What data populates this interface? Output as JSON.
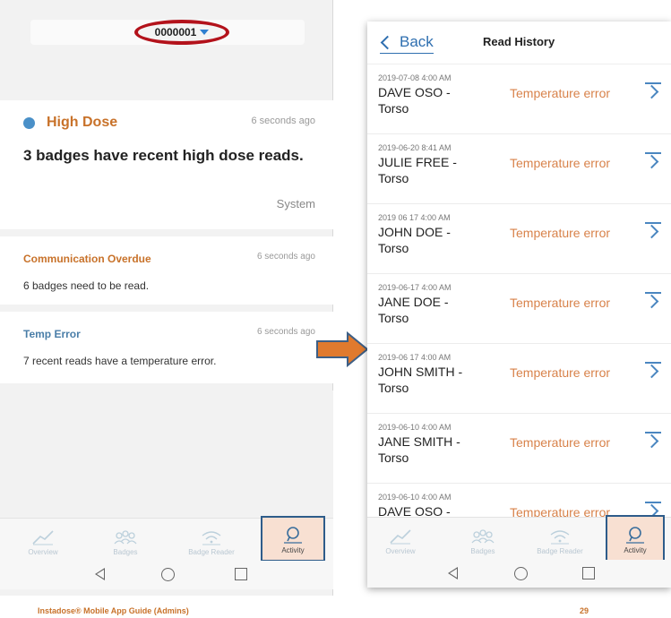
{
  "left_screen": {
    "badge_selector": {
      "value": "0000001"
    },
    "cards": {
      "high_dose": {
        "title": "High Dose",
        "time": "6 seconds ago",
        "message": "3 badges have recent high dose reads.",
        "source": "System"
      },
      "communication_overdue": {
        "title": "Communication Overdue",
        "time": "6 seconds ago",
        "message": "6 badges need to be read."
      },
      "temp_error": {
        "title": "Temp Error",
        "time": "6 seconds ago",
        "message": "7 recent reads have a temperature error."
      }
    },
    "tabs": [
      {
        "label": "Overview",
        "icon": "chart-line-icon"
      },
      {
        "label": "Badges",
        "icon": "users-icon"
      },
      {
        "label": "Badge Reader",
        "icon": "wifi-icon"
      },
      {
        "label": "Activity",
        "icon": "chat-bubble-icon",
        "active": true
      }
    ]
  },
  "right_screen": {
    "header": {
      "back_label": "Back",
      "title": "Read History"
    },
    "rows": [
      {
        "timestamp": "2019-07-08 4:00 AM",
        "name": "DAVE OSO -",
        "location": "Torso",
        "status": "Temperature error"
      },
      {
        "timestamp": "2019-06-20 8:41 AM",
        "name": "JULIE FREE -",
        "location": "Torso",
        "status": "Temperature error"
      },
      {
        "timestamp": "2019 06 17 4:00 AM",
        "name": "JOHN DOE -",
        "location": "Torso",
        "status": "Temperature error"
      },
      {
        "timestamp": "2019-06-17 4:00 AM",
        "name": "JANE DOE -",
        "location": "Torso",
        "status": "Temperature error"
      },
      {
        "timestamp": "2019-06 17 4:00 AM",
        "name": "JOHN SMITH -",
        "location": "Torso",
        "status": "Temperature error"
      },
      {
        "timestamp": "2019-06-10 4:00 AM",
        "name": "JANE SMITH -",
        "location": "Torso",
        "status": "Temperature error"
      },
      {
        "timestamp": "2019-06-10 4:00 AM",
        "name": "DAVE OSO -",
        "location": "",
        "status": "Temperature error"
      }
    ],
    "tabs": [
      {
        "label": "Overview",
        "icon": "chart-line-icon"
      },
      {
        "label": "Badges",
        "icon": "users-icon"
      },
      {
        "label": "Badge Reader",
        "icon": "wifi-icon"
      },
      {
        "label": "Activity",
        "icon": "chat-bubble-icon",
        "active": true
      }
    ]
  },
  "colors": {
    "accent_orange": "#c8722a",
    "link_blue": "#2f6fb0",
    "highlight_red": "#b3121b",
    "arrow_orange": "#e07a2e"
  },
  "footer": {
    "guide_title": "Instadose® Mobile App Guide (Admins)",
    "page_number": "29"
  }
}
